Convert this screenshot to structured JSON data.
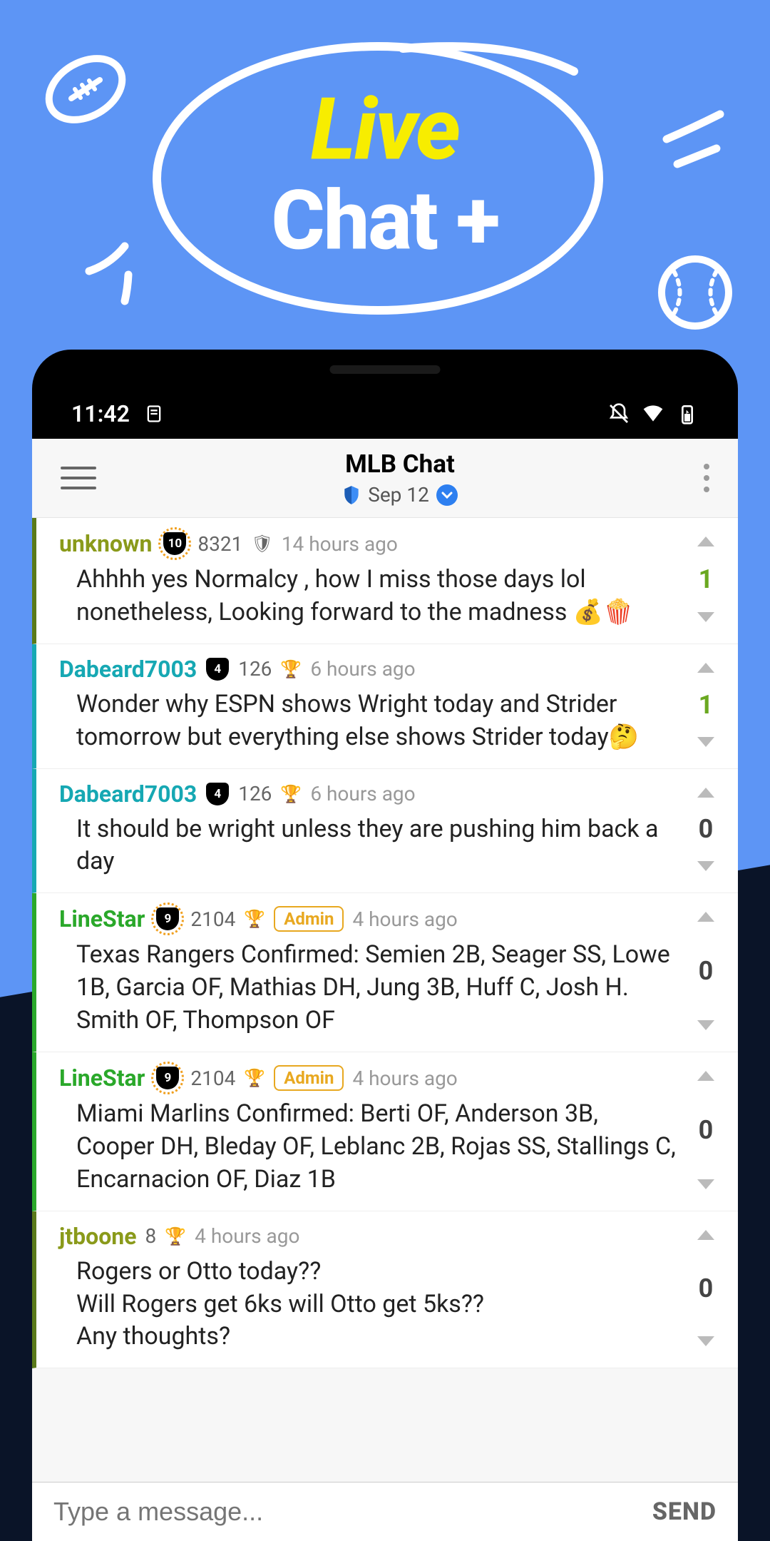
{
  "hero": {
    "live": "Live",
    "chat": "Chat +"
  },
  "status": {
    "time": "11:42"
  },
  "header": {
    "title": "MLB  Chat",
    "date": "Sep 12"
  },
  "messages": [
    {
      "user": "unknown",
      "level": "10",
      "count": "8321",
      "hasShield": true,
      "hasRing": true,
      "admin": false,
      "time": "14 hours ago",
      "body": "Ahhhh yes Normalcy , how I miss those days lol nonetheless, Looking forward to the madness 💰🍿",
      "votes": "1"
    },
    {
      "user": "Dabeard7003",
      "level": "4",
      "count": "126",
      "hasShield": false,
      "hasCrown": true,
      "hasRing": false,
      "admin": false,
      "time": "6 hours ago",
      "body": "Wonder why ESPN shows Wright today and Strider tomorrow but everything else shows Strider today🤔",
      "votes": "1"
    },
    {
      "user": "Dabeard7003",
      "level": "4",
      "count": "126",
      "hasShield": false,
      "hasCrown": true,
      "hasRing": false,
      "admin": false,
      "time": "6 hours ago",
      "body": "It should be wright unless they are pushing him back a day",
      "votes": "0"
    },
    {
      "user": "LineStar",
      "level": "9",
      "count": "2104",
      "hasShield": false,
      "hasCrown": true,
      "hasRing": true,
      "admin": true,
      "time": "4 hours ago",
      "body": "Texas Rangers Confirmed: Semien 2B, Seager SS, Lowe 1B, Garcia OF, Mathias DH, Jung 3B, Huff C, Josh H. Smith OF, Thompson OF",
      "votes": "0"
    },
    {
      "user": "LineStar",
      "level": "9",
      "count": "2104",
      "hasShield": false,
      "hasCrown": true,
      "hasRing": true,
      "admin": true,
      "time": "4 hours ago",
      "body": "Miami Marlins Confirmed: Berti OF, Anderson 3B, Cooper DH, Bleday OF, Leblanc 2B, Rojas SS, Stallings C, Encarnacion OF, Diaz 1B",
      "votes": "0"
    },
    {
      "user": "jtboone",
      "level": "",
      "count": "8",
      "hasShield": false,
      "hasCrown": true,
      "hasRing": false,
      "admin": false,
      "time": "4 hours ago",
      "body": "Rogers or Otto today??\nWill Rogers get 6ks will Otto get 5ks??\nAny thoughts?",
      "votes": "0"
    }
  ],
  "admin_label": "Admin",
  "composer": {
    "placeholder": "Type a message...",
    "send": "SEND"
  }
}
